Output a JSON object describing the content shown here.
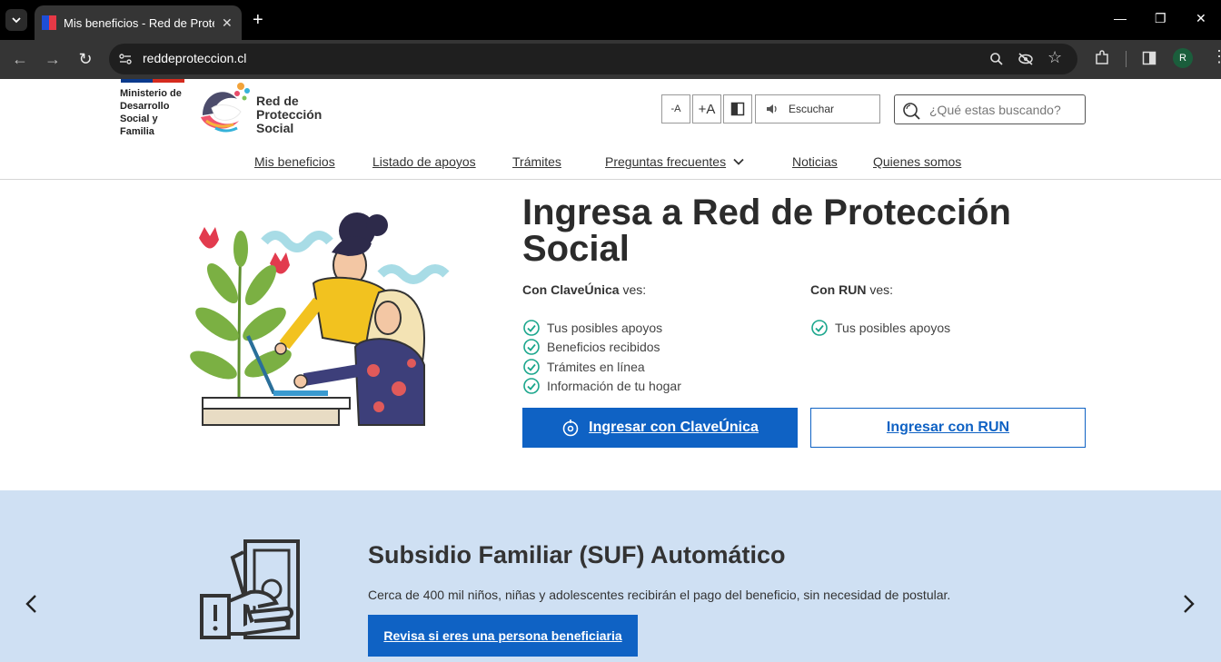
{
  "browser": {
    "tab_title": "Mis beneficios - Red de Protecc",
    "url": "reddeproteccion.cl",
    "profile_initial": "R"
  },
  "header": {
    "ministry": [
      "Ministerio de",
      "Desarrollo",
      "Social y",
      "Familia"
    ],
    "brand": [
      "Red de",
      "Protección",
      "Social"
    ],
    "a11y": {
      "decrease": "-A",
      "increase": "+A",
      "listen": "Escuchar"
    },
    "search_placeholder": "¿Qué estas buscando?"
  },
  "nav": {
    "items": [
      "Mis beneficios",
      "Listado de apoyos",
      "Trámites",
      "Preguntas frecuentes",
      "Noticias",
      "Quienes somos"
    ]
  },
  "hero": {
    "title": "Ingresa a Red de Protección Social",
    "clave": {
      "heading_bold": "Con ClaveÚnica",
      "heading_rest": " ves:",
      "items": [
        "Tus posibles apoyos",
        "Beneficios recibidos",
        "Trámites en línea",
        "Información de tu hogar"
      ],
      "button": "Ingresar con ClaveÚnica"
    },
    "run": {
      "heading_bold": "Con RUN",
      "heading_rest": " ves:",
      "items": [
        "Tus posibles apoyos"
      ],
      "button": "Ingresar con RUN"
    }
  },
  "carousel": {
    "title": "Subsidio Familiar (SUF) Automático",
    "description": "Cerca de 400 mil niños, niñas y adolescentes recibirán el pago del beneficio, sin necesidad de postular.",
    "button": "Revisa si eres una persona beneficiaria"
  },
  "colors": {
    "primary": "#0f62c4",
    "carousel_bg": "#cfe0f3",
    "check": "#1aa68c"
  }
}
